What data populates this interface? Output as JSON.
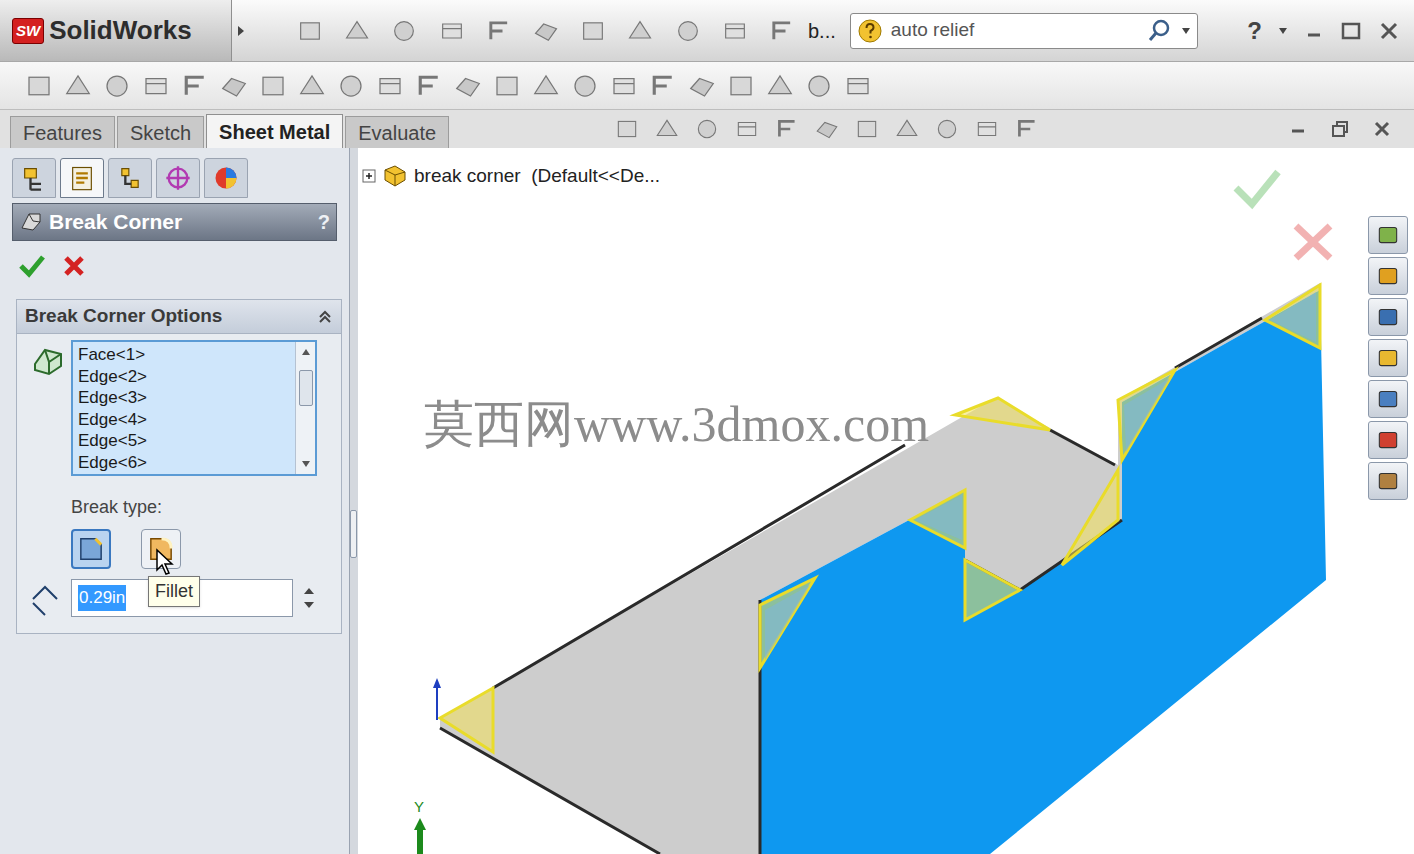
{
  "app": {
    "badge": "SW",
    "name": "SolidWorks",
    "document": "b...",
    "search": "auto relief",
    "help": "?"
  },
  "command_tabs": [
    {
      "label": "Features",
      "selected": false
    },
    {
      "label": "Sketch",
      "selected": false
    },
    {
      "label": "Sheet Metal",
      "selected": true
    },
    {
      "label": "Evaluate",
      "selected": false
    }
  ],
  "property_tabs": [
    {
      "kind": "tree",
      "selected": false
    },
    {
      "kind": "property",
      "selected": true
    },
    {
      "kind": "configuration",
      "selected": false
    },
    {
      "kind": "dimxpert",
      "selected": false
    },
    {
      "kind": "display",
      "selected": false
    }
  ],
  "property_manager": {
    "title": "Break Corner",
    "help": "?",
    "group": "Break Corner Options",
    "group_expanded": true,
    "selections": [
      "Face<1>",
      "Edge<2>",
      "Edge<3>",
      "Edge<4>",
      "Edge<5>",
      "Edge<6>"
    ],
    "break_type_label": "Break type:",
    "break_types": [
      {
        "kind": "chamfer",
        "selected": true
      },
      {
        "kind": "fillet",
        "selected": false
      }
    ],
    "tooltip": "Fillet",
    "distance": "0.29in"
  },
  "tree": {
    "expanded": false,
    "label": "break corner  (Default<<De..."
  },
  "watermark": "莫西网www.3dmox.com",
  "triad": {
    "label": "Y"
  }
}
